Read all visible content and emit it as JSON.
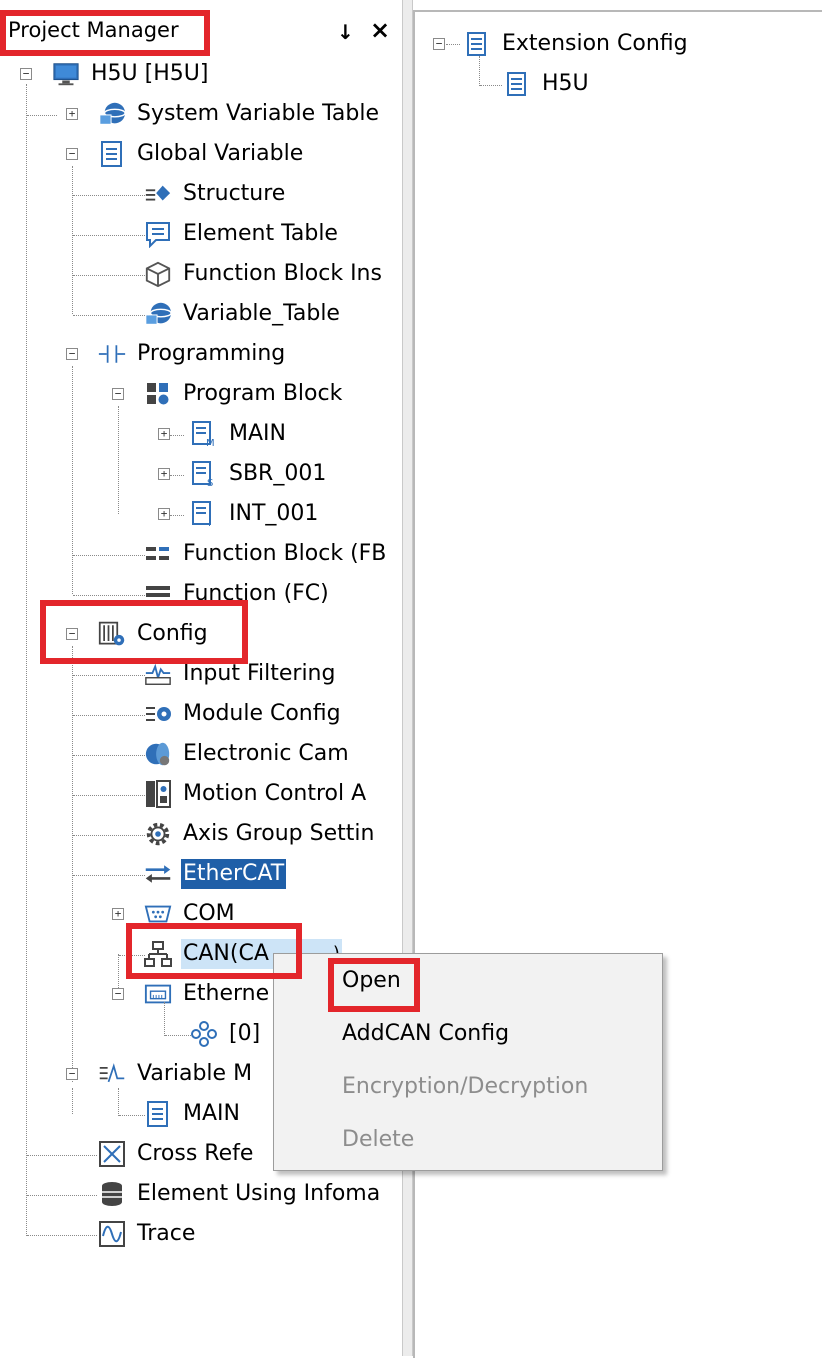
{
  "project_manager": {
    "title": "Project Manager",
    "pin_glyph": "↓",
    "close_glyph": "×"
  },
  "tree": {
    "root": "H5U [H5U]",
    "system_variable_table": "System Variable Table",
    "global_variable": "Global Variable",
    "structure": "Structure",
    "element_table": "Element Table",
    "function_block_instance": "Function Block Ins",
    "variable_table": "Variable_Table",
    "programming": "Programming",
    "program_block": "Program Block",
    "main": "MAIN",
    "sbr_001": "SBR_001",
    "int_001": "INT_001",
    "function_block_fb": "Function Block (FB",
    "function_fc": "Function (FC)",
    "config": "Config",
    "input_filtering": "Input Filtering",
    "module_config": "Module Config",
    "electronic_cam": "Electronic Cam",
    "motion_control": "Motion Control A",
    "axis_group_setting": "Axis Group Settin",
    "ethercat": "EtherCAT",
    "com": "COM",
    "can": "CAN(CA",
    "can_tail": ")",
    "ethernet": "Etherne",
    "ethernet_child": "[0]",
    "variable_monitor": "Variable M",
    "variable_monitor_main": "MAIN",
    "cross_reference": "Cross Refe",
    "element_using_info": "Element Using Infoma",
    "trace": "Trace"
  },
  "right_tree": {
    "extension_config": "Extension Config",
    "h5u": "H5U"
  },
  "context_menu": {
    "open": "Open",
    "add_can_config": "AddCAN Config",
    "encryption_decryption": "Encryption/Decryption",
    "delete": "Delete"
  },
  "colors": {
    "highlight": "#e3262b",
    "selection": "#1f5fa8",
    "icon_blue": "#2f6fb8"
  }
}
